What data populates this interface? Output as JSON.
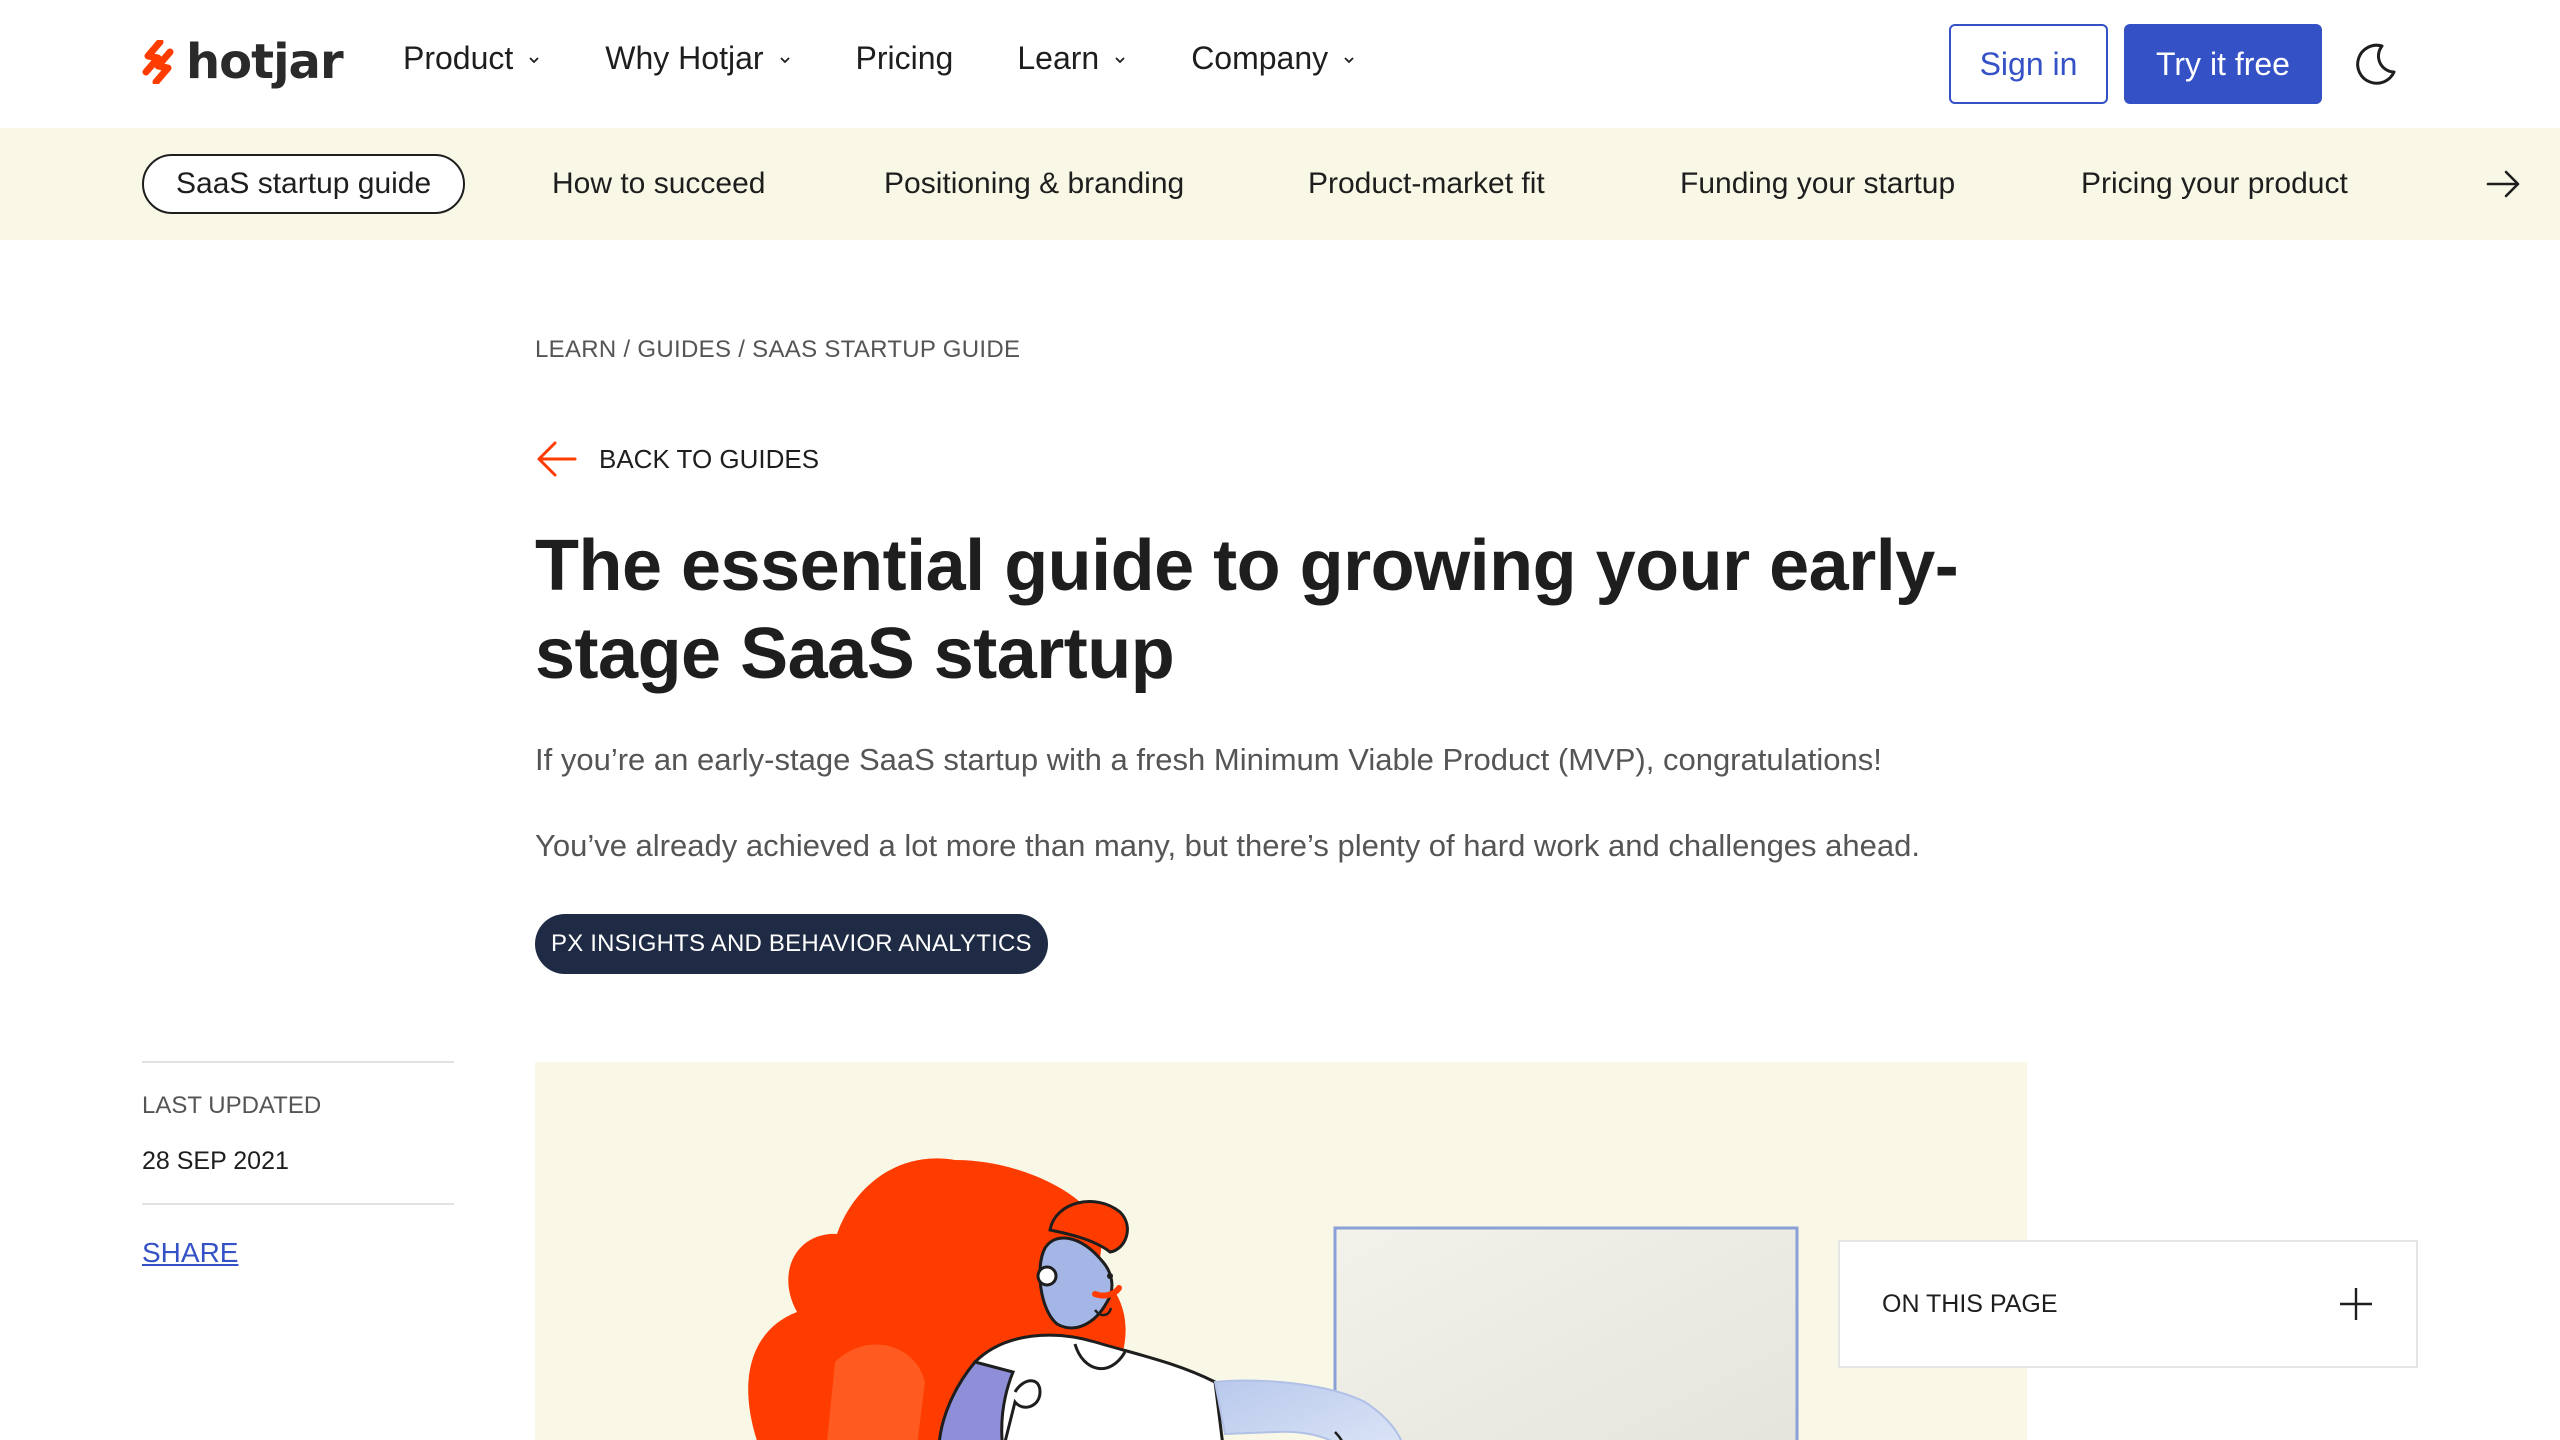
{
  "header": {
    "logo_text": "hotjar",
    "nav": [
      {
        "label": "Product",
        "has_dropdown": true
      },
      {
        "label": "Why Hotjar",
        "has_dropdown": true
      },
      {
        "label": "Pricing",
        "has_dropdown": false
      },
      {
        "label": "Learn",
        "has_dropdown": true
      },
      {
        "label": "Company",
        "has_dropdown": true
      }
    ],
    "sign_in_label": "Sign in",
    "try_label": "Try it free",
    "theme_icon": "moon-icon"
  },
  "subnav": {
    "items": [
      {
        "label": "SaaS startup guide",
        "active": true
      },
      {
        "label": "How to succeed",
        "active": false
      },
      {
        "label": "Positioning & branding",
        "active": false
      },
      {
        "label": "Product-market fit",
        "active": false
      },
      {
        "label": "Funding your startup",
        "active": false
      },
      {
        "label": "Pricing your product",
        "active": false
      }
    ],
    "next_icon": "arrow-right-icon"
  },
  "article": {
    "breadcrumb": "LEARN / GUIDES / SAAS STARTUP GUIDE",
    "back_label": "BACK TO GUIDES",
    "title_line1": "The essential guide to growing your early-",
    "title_line2": "stage SaaS startup",
    "intro_1": "If you’re an early-stage SaaS startup with a fresh Minimum Viable Product (MVP), congratulations!",
    "intro_2": "You’ve already achieved a lot more than many, but there’s plenty of hard work and challenges ahead.",
    "tag": "PX INSIGHTS AND BEHAVIOR ANALYTICS"
  },
  "sidebar": {
    "last_updated_label": "LAST UPDATED",
    "last_updated_date": "28 SEP 2021",
    "share_label": "SHARE"
  },
  "on_this_page": {
    "label": "ON THIS PAGE",
    "icon": "plus-icon"
  },
  "colors": {
    "brand_orange": "#ff3c00",
    "primary_blue": "#3452c6",
    "banner_cream": "#f9f8e6",
    "tag_navy": "#1f2a44"
  }
}
